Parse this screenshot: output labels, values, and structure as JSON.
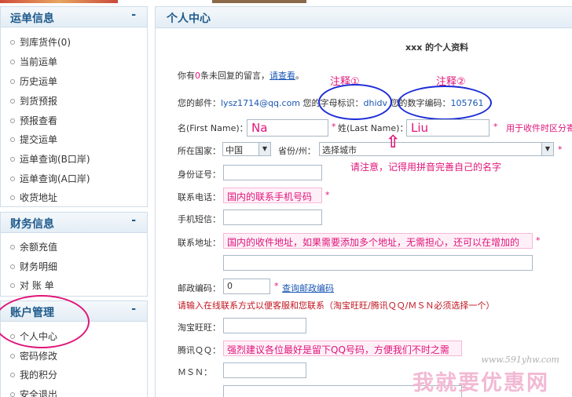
{
  "sidebar": {
    "sections": [
      {
        "title": "运单信息",
        "toggle": "-",
        "items": [
          "到库货件(0)",
          "当前运单",
          "历史运单",
          "到货预报",
          "预报查看",
          "提交运单",
          "运单查询(B口岸)",
          "运单查询(A口岸)",
          "收货地址"
        ]
      },
      {
        "title": "财务信息",
        "toggle": "-",
        "items": [
          "余额充值",
          "财务明细",
          "对 账 单"
        ]
      },
      {
        "title": "账户管理",
        "toggle": "-",
        "items": [
          "个人中心",
          "密码修改",
          "我的积分",
          "安全退出"
        ]
      }
    ]
  },
  "main": {
    "title": "个人中心",
    "profile_heading": "xxx 的个人资料",
    "message": {
      "prefix": "你有",
      "count": "0",
      "middle": "条未回复的留言，",
      "link": "请查看",
      "suffix": "。"
    },
    "email_line": {
      "label": "您的邮件：",
      "value": "lysz1714@qq.com",
      "id_label": "您的字母标识：",
      "id_value": "dhidv",
      "num_label": "您的数字编码：",
      "num_value": "105761"
    },
    "first_name": {
      "label": "名(First Name)：",
      "value": "Na"
    },
    "last_name": {
      "label": "姓(Last Name)：",
      "value": "Liu"
    },
    "name_note": "用于收件时区分寄",
    "country": {
      "label": "所在国家：",
      "value": "中国"
    },
    "province": {
      "label": "省份/州：",
      "value": "选择城市"
    },
    "id_number": {
      "label": "身份证号：",
      "value": ""
    },
    "phone": {
      "label": "联系电话：",
      "value": "国内的联系手机号码"
    },
    "sms": {
      "label": "手机短信：",
      "value": ""
    },
    "address": {
      "label": "联系地址：",
      "value": "国内的收件地址，如果需要添加多个地址，无需担心，还可以在增加的",
      "value2": ""
    },
    "postcode": {
      "label": "邮政编码：",
      "value": "0",
      "link": "查询邮政编码"
    },
    "online_notice": "请输入在线联系方式以便客服和您联系（淘宝旺旺/腾讯ＱＱ/ＭＳＮ必须选择一个）",
    "taobao": {
      "label": "淘宝旺旺：",
      "value": ""
    },
    "qq": {
      "label": "腾讯ＱＱ：",
      "value": "强烈建议各位最好是留下QQ号码，方便我们不时之需"
    },
    "msn": {
      "label": "ＭＳＮ：",
      "value": ""
    }
  },
  "annotations": {
    "note1": "注释①",
    "note2": "注释②",
    "name_tip": "请注意，记得用拼音完善自己的名字",
    "required_mark": "*"
  },
  "watermark": {
    "url": "www.591yhw.com",
    "text": "我就要优惠网"
  },
  "colors": {
    "accent": "#1f5a8c",
    "annotation_pink": "#e0157a",
    "annotation_blue": "#1a2bd6",
    "link": "#1a57b5"
  }
}
